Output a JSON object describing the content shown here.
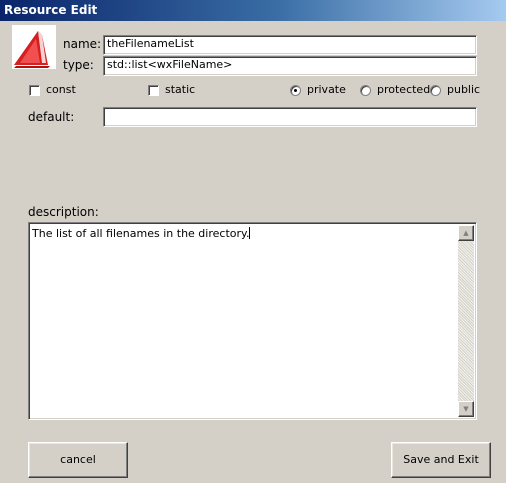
{
  "window": {
    "title": "Resource Edit"
  },
  "icon": {
    "name": "resource-icon",
    "color": "#e03a3a"
  },
  "name": {
    "label": "name:",
    "value": "theFilenameList"
  },
  "type": {
    "label": "type:",
    "value": "std::list<wxFileName>"
  },
  "modifiers": {
    "const_label": "const",
    "static_label": "static",
    "const_checked": false,
    "static_checked": false
  },
  "access": {
    "options": [
      "private",
      "protected",
      "public"
    ],
    "selected": "private"
  },
  "default": {
    "label": "default:",
    "value": ""
  },
  "description": {
    "label": "description:",
    "value": "The list of all filenames in the directory."
  },
  "scroll": {
    "up_icon": "scroll-up-arrow-icon",
    "down_icon": "scroll-down-arrow-icon"
  },
  "buttons": {
    "cancel": "cancel",
    "save": "Save and Exit"
  }
}
